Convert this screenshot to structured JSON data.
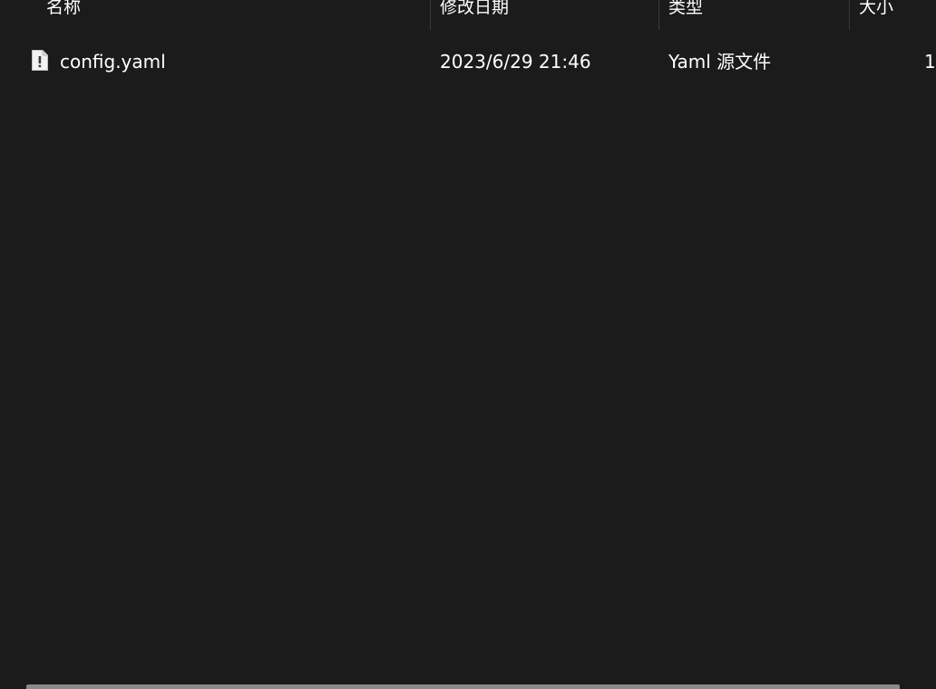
{
  "columns": {
    "name": "名称",
    "date": "修改日期",
    "type": "类型",
    "size": "大小"
  },
  "files": [
    {
      "name": "config.yaml",
      "modified": "2023/6/29 21:46",
      "type": "Yaml 源文件",
      "size": "1",
      "icon": "yaml-file-icon"
    }
  ],
  "colors": {
    "background": "#1b1b1b",
    "text": "#ffffff",
    "separator": "#3a3a3a",
    "scrollbar_thumb": "#8a8a8a"
  }
}
